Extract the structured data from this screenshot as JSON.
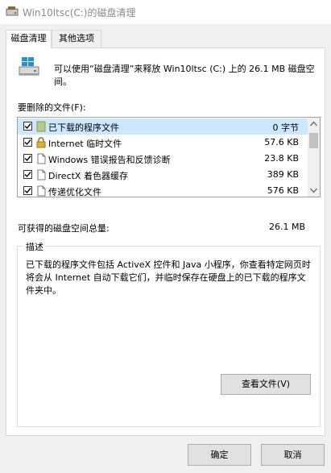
{
  "window": {
    "title": "Win10ltsc(C:)的磁盘清理"
  },
  "tabs": [
    {
      "label": "磁盘清理",
      "active": true
    },
    {
      "label": "其他选项",
      "active": false
    }
  ],
  "intro": {
    "text": "可以使用“磁盘清理”来释放 Win10ltsc (C:) 上的 26.1 MB 磁盘空间。"
  },
  "files": {
    "label": "要删除的文件(F):",
    "items": [
      {
        "name": "已下载的程序文件",
        "size": "0 字节",
        "checked": true,
        "icon": "folder-icon",
        "selected": true
      },
      {
        "name": "Internet 临时文件",
        "size": "57.6 KB",
        "checked": true,
        "icon": "lock-icon",
        "selected": false
      },
      {
        "name": "Windows 错误报告和反馈诊断",
        "size": "23.8 KB",
        "checked": true,
        "icon": "file-icon",
        "selected": false
      },
      {
        "name": "DirectX 着色器缓存",
        "size": "389 KB",
        "checked": true,
        "icon": "file-icon",
        "selected": false
      },
      {
        "name": "传递优化文件",
        "size": "576 KB",
        "checked": true,
        "icon": "file-icon",
        "selected": false
      }
    ]
  },
  "total": {
    "label": "可获得的磁盘空间总量:",
    "value": "26.1 MB"
  },
  "description": {
    "legend": "描述",
    "text": "已下载的程序文件包括 ActiveX 控件和 Java 小程序，你查看特定网页时将会从 Internet 自动下载它们，并临时保存在硬盘上的已下载的程序文件夹中。",
    "view_button": "查看文件(V)"
  },
  "buttons": {
    "ok": "确定",
    "cancel": "取消"
  }
}
